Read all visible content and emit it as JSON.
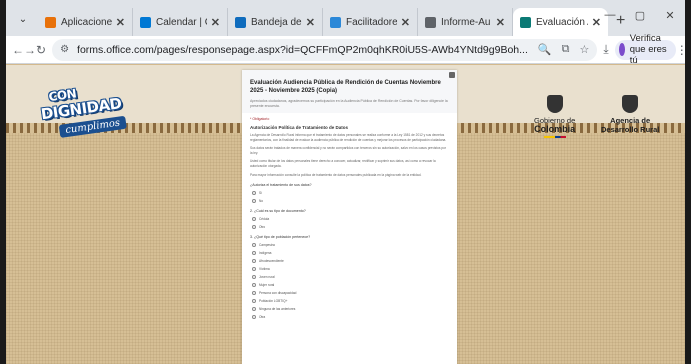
{
  "browser": {
    "tabs": [
      {
        "label": "Aplicaciones",
        "fav_color": "#e8710a",
        "active": false
      },
      {
        "label": "Calendar | C",
        "fav_color": "#0078d4",
        "active": false
      },
      {
        "label": "Bandeja de e",
        "fav_color": "#0f6cbd",
        "active": false
      },
      {
        "label": "Facilitadores",
        "fav_color": "#2b88d8",
        "active": false
      },
      {
        "label": "Informe-Au",
        "fav_color": "#5f6368",
        "active": false
      },
      {
        "label": "Evaluación A",
        "fav_color": "#0b7a75",
        "active": true
      }
    ],
    "url": "forms.office.com/pages/responsepage.aspx?id=QCFFmQP2m0qhKR0iU5S-AWb4YNtd9g9Boh...",
    "profile_label": "Verifica que eres tú"
  },
  "page": {
    "logo_left": {
      "line1": "CON",
      "line2": "DIGNIDAD",
      "line3": "cumplimos"
    },
    "gov1": {
      "line1": "Gobierno de",
      "line2": "Colombia"
    },
    "gov2": {
      "line1": "Agencia de",
      "line2": "Desarrollo Rural"
    }
  },
  "form": {
    "title": "Evaluación Audiencia Pública de Rendición de Cuentas Noviembre 2025 - Noviembre 2025 (Copia)",
    "description": "Apreciados ciudadanos, agradecemos su participación en la Audiencia Pública de Rendición de Cuentas. Por favor diligencie la presente encuesta.",
    "required_note": "* Obligatorio",
    "section_title": "Autorización Política de Tratamiento de Datos",
    "paragraphs": [
      "La Agencia de Desarrollo Rural informa que el tratamiento de datos personales se realiza conforme a la Ley 1581 de 2012 y sus decretos reglamentarios, con la finalidad de evaluar la audiencia pública de rendición de cuentas y mejorar los procesos de participación ciudadana.",
      "Sus datos serán tratados de manera confidencial y no serán compartidos con terceros sin su autorización, salvo en los casos previstos por la ley.",
      "Usted como titular de los datos personales tiene derecho a conocer, actualizar, rectificar y suprimir sus datos, así como a revocar la autorización otorgada.",
      "Para mayor información consulte la política de tratamiento de datos personales publicada en la página web de la entidad."
    ],
    "q1": "¿Autoriza el tratamiento de sus datos?",
    "q1_options": [
      "Sí",
      "No"
    ],
    "q2": "2. ¿Cuál es su tipo de documento?",
    "q2_options": [
      "Cédula",
      "Otro"
    ],
    "q3": "3. ¿Qué tipo de población pertenece?",
    "q3_options": [
      "Campesino",
      "Indígena",
      "Afrodescendiente",
      "Víctima",
      "Joven rural",
      "Mujer rural",
      "Persona con discapacidad",
      "Población LGBTIQ+",
      "Ninguna de las anteriores",
      "Otra"
    ]
  }
}
